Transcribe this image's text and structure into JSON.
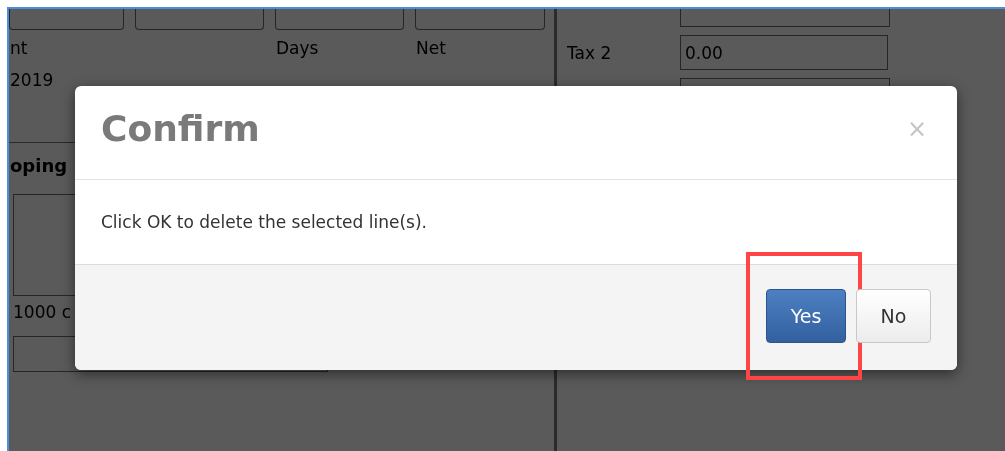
{
  "background_form": {
    "first_label": "nt",
    "days_label": "Days",
    "net_label": "Net",
    "date_value": "2019",
    "section_title": "oping",
    "note_text": "1000 c",
    "tax_label": "Tax 2",
    "tax_value": "0.00"
  },
  "dialog": {
    "title": "Confirm",
    "close": "×",
    "message": "Click OK to delete the selected line(s).",
    "buttons": [
      {
        "label": "Yes",
        "kind": "primary",
        "highlighted": true
      },
      {
        "label": "No",
        "kind": "default",
        "highlighted": false
      }
    ]
  }
}
